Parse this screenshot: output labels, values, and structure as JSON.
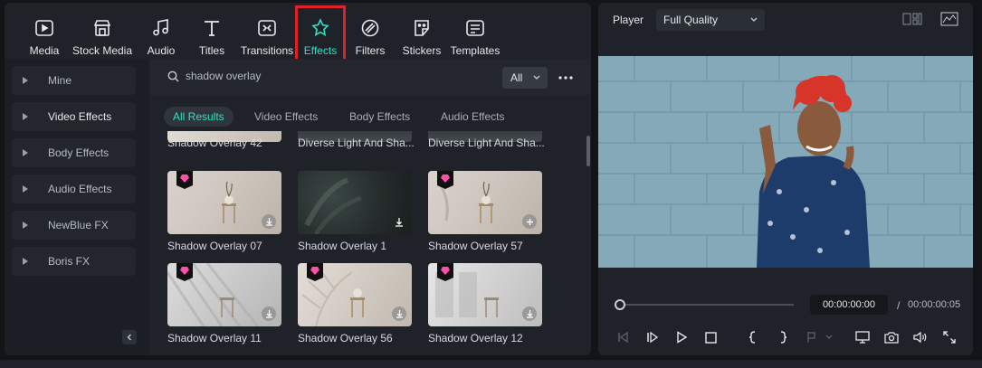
{
  "toolbar": {
    "items": [
      {
        "label": "Media",
        "icon": "media-icon"
      },
      {
        "label": "Stock Media",
        "icon": "stock-media-icon"
      },
      {
        "label": "Audio",
        "icon": "audio-icon"
      },
      {
        "label": "Titles",
        "icon": "titles-icon"
      },
      {
        "label": "Transitions",
        "icon": "transitions-icon"
      },
      {
        "label": "Effects",
        "icon": "effects-icon",
        "active": true
      },
      {
        "label": "Filters",
        "icon": "filters-icon"
      },
      {
        "label": "Stickers",
        "icon": "stickers-icon"
      },
      {
        "label": "Templates",
        "icon": "templates-icon"
      }
    ],
    "accent_color": "#32e0c4",
    "highlight_color": "#e0202a"
  },
  "sidebar": {
    "items": [
      {
        "label": "Mine"
      },
      {
        "label": "Video Effects",
        "active": true
      },
      {
        "label": "Body Effects"
      },
      {
        "label": "Audio Effects"
      },
      {
        "label": "NewBlue FX"
      },
      {
        "label": "Boris FX"
      }
    ]
  },
  "search": {
    "value": "shadow overlay",
    "filter": "All"
  },
  "tabs": [
    {
      "label": "All Results",
      "active": true
    },
    {
      "label": "Video Effects"
    },
    {
      "label": "Body Effects"
    },
    {
      "label": "Audio Effects"
    }
  ],
  "results": {
    "partial_row": [
      "Shadow Overlay 42",
      "Diverse Light And Sha...",
      "Diverse Light And Sha..."
    ],
    "row1": [
      {
        "label": "Shadow Overlay 07",
        "premium": true,
        "action": "download"
      },
      {
        "label": "Shadow Overlay 1",
        "premium": false,
        "action": "download"
      },
      {
        "label": "Shadow Overlay 57",
        "premium": true,
        "action": "add"
      }
    ],
    "row2": [
      {
        "label": "Shadow Overlay 11",
        "premium": true,
        "action": "download"
      },
      {
        "label": "Shadow Overlay 56",
        "premium": true,
        "action": "download"
      },
      {
        "label": "Shadow Overlay 12",
        "premium": true,
        "action": "download"
      }
    ]
  },
  "player": {
    "label": "Player",
    "quality": "Full Quality",
    "current_time": "00:00:00:00",
    "separator": "/",
    "total_time": "00:00:00:05",
    "progress": 0
  }
}
